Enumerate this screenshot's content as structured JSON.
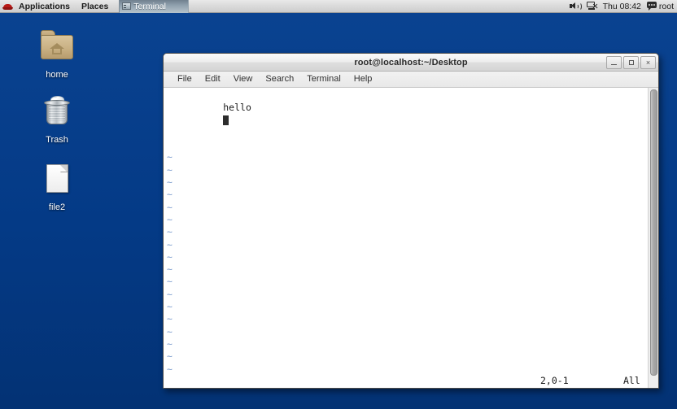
{
  "panel": {
    "logo_icon": "redhat-logo-icon",
    "applications_label": "Applications",
    "places_label": "Places",
    "taskbar": {
      "terminal_label": "Terminal",
      "terminal_icon": "terminal-window-icon"
    },
    "tray": {
      "volume_icon": "speaker-icon",
      "network_icon": "network-disconnected-icon",
      "clock": "Thu 08:42",
      "user_icon": "user-chat-icon",
      "user_label": "root"
    }
  },
  "desktop": {
    "background_color": "#043a86",
    "icons": [
      {
        "name": "home",
        "label": "home",
        "icon": "folder-home-icon"
      },
      {
        "name": "trash",
        "label": "Trash",
        "icon": "trash-bin-icon"
      },
      {
        "name": "file2",
        "label": "file2",
        "icon": "text-document-icon"
      }
    ]
  },
  "window": {
    "title": "root@localhost:~/Desktop",
    "controls": {
      "minimize": "minimize-button",
      "maximize": "maximize-button",
      "close": "×"
    },
    "menu": [
      {
        "label": "File"
      },
      {
        "label": "Edit"
      },
      {
        "label": "View"
      },
      {
        "label": "Search"
      },
      {
        "label": "Terminal"
      },
      {
        "label": "Help"
      }
    ],
    "terminal": {
      "editor": "vim",
      "lines": [
        "hello"
      ],
      "cursor": {
        "row": 2,
        "col": 1,
        "glyph": "block"
      },
      "empty_line_marker": "~",
      "empty_line_count": 18,
      "status": {
        "ruler": "2,0-1",
        "scroll_position": "All"
      }
    },
    "scrollbar": {
      "name": "vertical-scrollbar"
    }
  },
  "colors": {
    "desktop_blue": "#043a86",
    "panel_gray": "#dcdcdc",
    "tilde_blue": "#7f9fcf",
    "cursor": "#2d2d2d"
  }
}
